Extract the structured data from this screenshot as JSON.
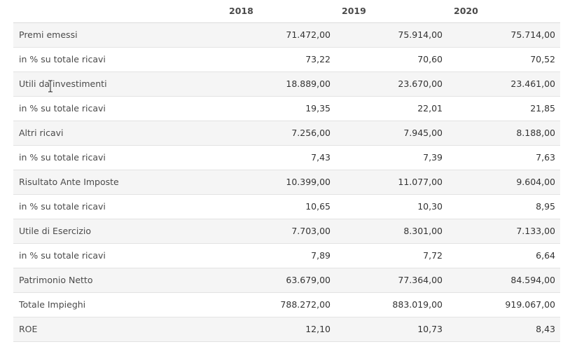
{
  "table": {
    "headers": [
      "2018",
      "2019",
      "2020"
    ],
    "rows": [
      {
        "label": "Premi emessi",
        "values": [
          "71.472,00",
          "75.914,00",
          "75.714,00"
        ]
      },
      {
        "label": "in % su totale ricavi",
        "values": [
          "73,22",
          "70,60",
          "70,52"
        ]
      },
      {
        "label": "Utili da investimenti",
        "values": [
          "18.889,00",
          "23.670,00",
          "23.461,00"
        ]
      },
      {
        "label": "in % su totale ricavi",
        "values": [
          "19,35",
          "22,01",
          "21,85"
        ]
      },
      {
        "label": "Altri ricavi",
        "values": [
          "7.256,00",
          "7.945,00",
          "8.188,00"
        ]
      },
      {
        "label": "in % su totale ricavi",
        "values": [
          "7,43",
          "7,39",
          "7,63"
        ]
      },
      {
        "label": "Risultato Ante Imposte",
        "values": [
          "10.399,00",
          "11.077,00",
          "9.604,00"
        ]
      },
      {
        "label": "in % su totale ricavi",
        "values": [
          "10,65",
          "10,30",
          "8,95"
        ]
      },
      {
        "label": "Utile di Esercizio",
        "values": [
          "7.703,00",
          "8.301,00",
          "7.133,00"
        ]
      },
      {
        "label": "in % su totale ricavi",
        "values": [
          "7,89",
          "7,72",
          "6,64"
        ]
      },
      {
        "label": "Patrimonio Netto",
        "values": [
          "63.679,00",
          "77.364,00",
          "84.594,00"
        ]
      },
      {
        "label": "Totale Impieghi",
        "values": [
          "788.272,00",
          "883.019,00",
          "919.067,00"
        ]
      },
      {
        "label": "ROE",
        "values": [
          "12,10",
          "10,73",
          "8,43"
        ]
      }
    ]
  },
  "cursor": {
    "icon": "text-cursor-icon"
  }
}
